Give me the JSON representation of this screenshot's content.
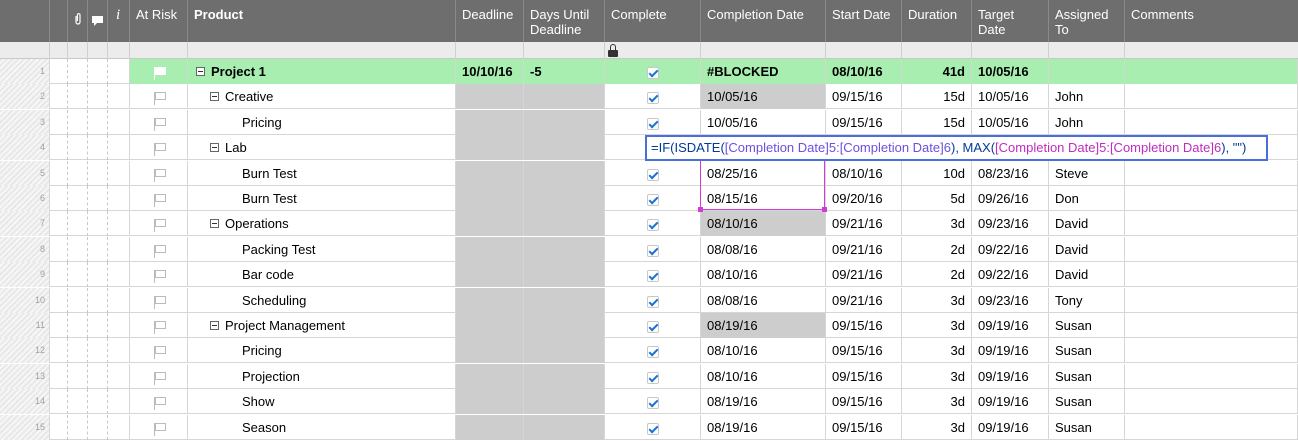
{
  "columns": {
    "at_risk": "At Risk",
    "product": "Product",
    "deadline": "Deadline",
    "days_until_deadline": "Days Until Deadline",
    "complete": "Complete",
    "completion_date": "Completion Date",
    "start_date": "Start Date",
    "duration": "Duration",
    "target_date": "Target Date",
    "assigned_to": "Assigned To",
    "comments": "Comments"
  },
  "header_icons": {
    "attachment": "paperclip-icon",
    "comment": "comment-icon",
    "info": "info-icon",
    "info_glyph": "i"
  },
  "rows": [
    {
      "num": "1",
      "product": "Project 1",
      "deadline": "10/10/16",
      "days": "-5",
      "completion": "#BLOCKED",
      "start": "08/10/16",
      "duration": "41d",
      "target": "10/05/16",
      "assigned": ""
    },
    {
      "num": "2",
      "product": "Creative",
      "deadline": "",
      "days": "",
      "completion": "10/05/16",
      "start": "09/15/16",
      "duration": "15d",
      "target": "10/05/16",
      "assigned": "John"
    },
    {
      "num": "3",
      "product": "Pricing",
      "deadline": "",
      "days": "",
      "completion": "10/05/16",
      "start": "09/15/16",
      "duration": "15d",
      "target": "10/05/16",
      "assigned": "John"
    },
    {
      "num": "4",
      "product": "Lab",
      "deadline": "",
      "days": "",
      "completion": "",
      "start": "",
      "duration": "",
      "target": "",
      "assigned": ""
    },
    {
      "num": "5",
      "product": "Burn Test",
      "deadline": "",
      "days": "",
      "completion": "08/25/16",
      "start": "08/10/16",
      "duration": "10d",
      "target": "08/23/16",
      "assigned": "Steve"
    },
    {
      "num": "6",
      "product": "Burn Test",
      "deadline": "",
      "days": "",
      "completion": "08/15/16",
      "start": "09/20/16",
      "duration": "5d",
      "target": "09/26/16",
      "assigned": "Don"
    },
    {
      "num": "7",
      "product": "Operations",
      "deadline": "",
      "days": "",
      "completion": "08/10/16",
      "start": "09/21/16",
      "duration": "3d",
      "target": "09/23/16",
      "assigned": "David"
    },
    {
      "num": "8",
      "product": "Packing Test",
      "deadline": "",
      "days": "",
      "completion": "08/08/16",
      "start": "09/21/16",
      "duration": "2d",
      "target": "09/22/16",
      "assigned": "David"
    },
    {
      "num": "9",
      "product": "Bar code",
      "deadline": "",
      "days": "",
      "completion": "08/10/16",
      "start": "09/21/16",
      "duration": "2d",
      "target": "09/22/16",
      "assigned": "David"
    },
    {
      "num": "10",
      "product": "Scheduling",
      "deadline": "",
      "days": "",
      "completion": "08/08/16",
      "start": "09/21/16",
      "duration": "3d",
      "target": "09/23/16",
      "assigned": "Tony"
    },
    {
      "num": "11",
      "product": "Project Management",
      "deadline": "",
      "days": "",
      "completion": "08/19/16",
      "start": "09/15/16",
      "duration": "3d",
      "target": "09/19/16",
      "assigned": "Susan"
    },
    {
      "num": "12",
      "product": "Pricing",
      "deadline": "",
      "days": "",
      "completion": "08/10/16",
      "start": "09/15/16",
      "duration": "3d",
      "target": "09/19/16",
      "assigned": "Susan"
    },
    {
      "num": "13",
      "product": "Projection",
      "deadline": "",
      "days": "",
      "completion": "08/10/16",
      "start": "09/15/16",
      "duration": "3d",
      "target": "09/19/16",
      "assigned": "Susan"
    },
    {
      "num": "14",
      "product": "Show",
      "deadline": "",
      "days": "",
      "completion": "08/19/16",
      "start": "09/15/16",
      "duration": "3d",
      "target": "09/19/16",
      "assigned": "Susan"
    },
    {
      "num": "15",
      "product": "Season",
      "deadline": "",
      "days": "",
      "completion": "08/19/16",
      "start": "09/15/16",
      "duration": "3d",
      "target": "09/19/16",
      "assigned": "Susan"
    }
  ],
  "formula": {
    "p1": "=IF(ISDATE(",
    "p2": "[Completion Date]5:[Completion Date]6",
    "p3": "), MAX(",
    "p4": "[Completion Date]5:[Completion Date]6",
    "p5": "), \"\")"
  },
  "colors": {
    "header_bg": "#6e6e6e",
    "parent_row": "#a7eeb0",
    "locked_cell": "#cdcdcd",
    "check": "#1a73d6",
    "formula_border": "#4a6fd9",
    "range_highlight": "#d13cd6"
  }
}
